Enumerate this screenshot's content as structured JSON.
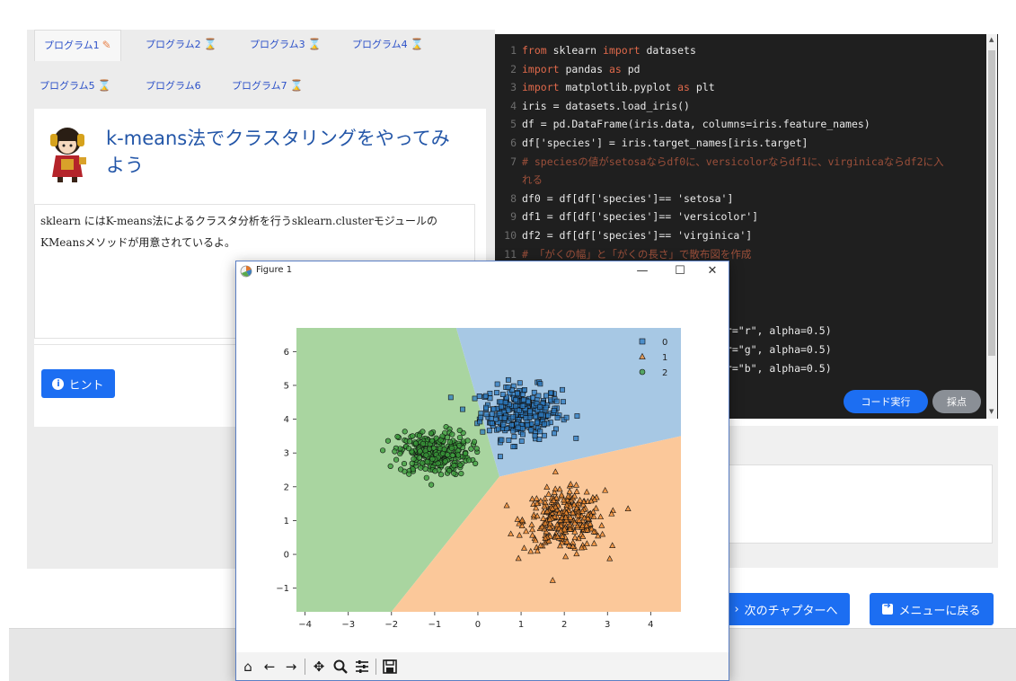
{
  "tabs": [
    {
      "label": "プログラム1",
      "icon": "pencil-icon",
      "active": true
    },
    {
      "label": "プログラム2",
      "icon": "hourglass-icon"
    },
    {
      "label": "プログラム3",
      "icon": "hourglass-icon"
    },
    {
      "label": "プログラム4",
      "icon": "hourglass-icon"
    },
    {
      "label": "プログラム5",
      "icon": "hourglass-icon"
    },
    {
      "label": "プログラム6",
      "icon": ""
    },
    {
      "label": "プログラム7",
      "icon": "hourglass-icon"
    }
  ],
  "lesson": {
    "title": "k-means法でクラスタリングをやってみよう",
    "body": "sklearn にはK-means法によるクラスタ分析を行うsklearn.clusterモジュールのKMeansメソッドが用意されているよ。"
  },
  "hint_button": "ヒント",
  "code": {
    "lines": [
      {
        "n": "1",
        "parts": [
          {
            "t": "from",
            "c": "kw"
          },
          {
            "t": " sklearn "
          },
          {
            "t": "import",
            "c": "kw"
          },
          {
            "t": " datasets"
          }
        ]
      },
      {
        "n": "2",
        "parts": [
          {
            "t": "import",
            "c": "kw"
          },
          {
            "t": " pandas "
          },
          {
            "t": "as",
            "c": "kw"
          },
          {
            "t": " pd"
          }
        ]
      },
      {
        "n": "3",
        "parts": [
          {
            "t": "import",
            "c": "kw"
          },
          {
            "t": " matplotlib.pyplot "
          },
          {
            "t": "as",
            "c": "kw"
          },
          {
            "t": " plt"
          }
        ]
      },
      {
        "n": "4",
        "parts": [
          {
            "t": "iris = datasets.load_iris()"
          }
        ]
      },
      {
        "n": "5",
        "parts": [
          {
            "t": "df = pd.DataFrame(iris.data, columns=iris.feature_names)"
          }
        ]
      },
      {
        "n": "6",
        "parts": [
          {
            "t": "df['species'] = iris.target_names[iris.target]"
          }
        ]
      },
      {
        "n": "7",
        "parts": [
          {
            "t": "# speciesの値がsetosaならdf0に、versicolorならdf1に、virginicaならdf2に入",
            "c": "cm"
          }
        ]
      },
      {
        "n": "",
        "parts": [
          {
            "t": "れる",
            "c": "cm"
          }
        ]
      },
      {
        "n": "8",
        "parts": [
          {
            "t": "df0 = df[df['species']== 'setosa']"
          }
        ]
      },
      {
        "n": "9",
        "parts": [
          {
            "t": "df1 = df[df['species']== 'versicolor']"
          }
        ]
      },
      {
        "n": "10",
        "parts": [
          {
            "t": "df2 = df[df['species']== 'virginica']"
          }
        ]
      },
      {
        "n": "11",
        "parts": [
          {
            "t": "# 「がくの幅」と「がくの長さ」で散布図を作成",
            "c": "cm"
          }
        ]
      }
    ],
    "hidden_tails": [
      "or=\"r\", alpha=0.5)",
      "or=\"g\", alpha=0.5)",
      "or=\"b\", alpha=0.5)"
    ]
  },
  "run_button": "コード実行",
  "grade_button": "採点",
  "next_chapter_button": "次のチャプターへ",
  "menu_button": "メニューに戻る",
  "figure": {
    "title": "Figure 1",
    "controls": {
      "minimize": "—",
      "maximize": "☐",
      "close": "✕"
    }
  },
  "chart_data": {
    "type": "scatter",
    "title": "",
    "xlabel": "",
    "ylabel": "",
    "xlim": [
      -4.2,
      4.7
    ],
    "ylim": [
      -1.7,
      6.7
    ],
    "x_ticks": [
      "−4",
      "−3",
      "−2",
      "−1",
      "0",
      "1",
      "2",
      "3",
      "4"
    ],
    "y_ticks": [
      "−1",
      "0",
      "1",
      "2",
      "3",
      "4",
      "5",
      "6"
    ],
    "legend": {
      "placement": "top-right",
      "entries": [
        "0",
        "1",
        "2"
      ]
    },
    "decision_regions": [
      {
        "label": "0",
        "color": "#a7c8e4"
      },
      {
        "label": "1",
        "color": "#fbc89a"
      },
      {
        "label": "2",
        "color": "#a9d5a0"
      }
    ],
    "region_vertices": {
      "center": [
        0.5,
        2.3
      ],
      "top": [
        -0.5,
        6.7
      ],
      "bottom_left": [
        -2.0,
        -1.7
      ],
      "right": [
        4.7,
        3.5
      ]
    },
    "series": [
      {
        "name": "0",
        "marker": "square",
        "color": "#2d7bc0",
        "center": [
          1.0,
          4.2
        ],
        "spread": [
          0.85,
          0.7
        ],
        "count": 300
      },
      {
        "name": "1",
        "marker": "triangle",
        "color": "#f08a2e",
        "center": [
          2.0,
          1.0
        ],
        "spread": [
          0.85,
          0.8
        ],
        "count": 300
      },
      {
        "name": "2",
        "marker": "circle",
        "color": "#3a9a3a",
        "center": [
          -1.0,
          3.0
        ],
        "spread": [
          0.75,
          0.6
        ],
        "count": 300
      }
    ]
  }
}
